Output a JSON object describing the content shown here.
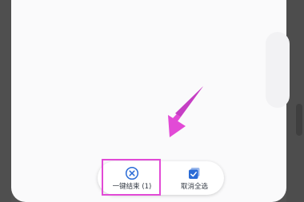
{
  "actions": {
    "end_all": {
      "label": "一键结束 (1)",
      "icon": "close-circle-icon"
    },
    "cancel_select_all": {
      "label": "取消全选",
      "icon": "checkbox-checked-icon"
    }
  },
  "colors": {
    "accent": "#2a6bd6",
    "highlight": "#e24ad6",
    "background_dim": "#525252",
    "panel": "#fafafb"
  },
  "annotation": {
    "arrow_icon": "arrow-pointer-icon",
    "highlight_target": "end-all-button"
  }
}
